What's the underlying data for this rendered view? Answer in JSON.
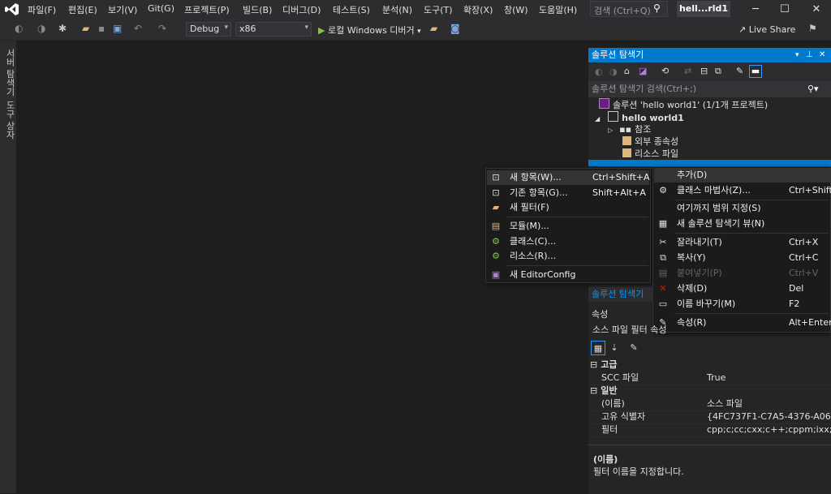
{
  "menubar": {
    "items": [
      "파일(F)",
      "편집(E)",
      "보기(V)",
      "Git(G)",
      "프로젝트(P)",
      "빌드(B)",
      "디버그(D)",
      "테스트(S)",
      "분석(N)",
      "도구(T)",
      "확장(X)",
      "창(W)",
      "도움말(H)"
    ],
    "search_placeholder": "검색 (Ctrl+Q)",
    "window_title": "hell...rld1"
  },
  "toolbar": {
    "config": "Debug",
    "platform": "x86",
    "run_label": "로컬 Windows 디버거",
    "live_share": "Live Share"
  },
  "left_strip": {
    "items": [
      "서버 탐색기",
      "도구 상자"
    ]
  },
  "solution_explorer": {
    "title": "솔루션 탐색기",
    "search_placeholder": "솔루션 탐색기 검색(Ctrl+;)",
    "tree": [
      {
        "label": "솔루션 'hello world1' (1/1개 프로젝트)",
        "icon": "solution-icon"
      },
      {
        "label": "hello world1",
        "icon": "project-icon"
      },
      {
        "label": "참조",
        "icon": "references-icon"
      },
      {
        "label": "외부 종속성",
        "icon": "external-deps-icon"
      },
      {
        "label": "리소스 파일",
        "icon": "folder-icon"
      }
    ]
  },
  "add_submenu": {
    "items": [
      {
        "label": "새 항목(W)...",
        "shortcut": "Ctrl+Shift+A",
        "icon": "new-item-icon"
      },
      {
        "label": "기존 항목(G)...",
        "shortcut": "Shift+Alt+A",
        "icon": "existing-item-icon"
      },
      {
        "label": "새 필터(F)",
        "shortcut": "",
        "icon": "new-filter-icon"
      },
      {
        "label": "모듈(M)...",
        "shortcut": "",
        "icon": "module-icon"
      },
      {
        "label": "클래스(C)...",
        "shortcut": "",
        "icon": "class-icon"
      },
      {
        "label": "리소스(R)...",
        "shortcut": "",
        "icon": "resource-icon"
      },
      {
        "label": "새 EditorConfig",
        "shortcut": "",
        "icon": "editorconfig-icon"
      }
    ]
  },
  "context_menu": {
    "items": [
      {
        "label": "추가(D)",
        "shortcut": "",
        "icon": ""
      },
      {
        "label": "클래스 마법사(Z)...",
        "shortcut": "Ctrl+Shift+X",
        "icon": "class-wizard-icon"
      },
      {
        "label": "여기까지 범위 지정(S)",
        "shortcut": "",
        "icon": ""
      },
      {
        "label": "새 솔루션 탐색기 뷰(N)",
        "shortcut": "",
        "icon": "new-view-icon"
      },
      {
        "label": "잘라내기(T)",
        "shortcut": "Ctrl+X",
        "icon": "cut-icon"
      },
      {
        "label": "복사(Y)",
        "shortcut": "Ctrl+C",
        "icon": "copy-icon"
      },
      {
        "label": "붙여넣기(P)",
        "shortcut": "Ctrl+V",
        "icon": "paste-icon"
      },
      {
        "label": "삭제(D)",
        "shortcut": "Del",
        "icon": "delete-icon"
      },
      {
        "label": "이름 바꾸기(M)",
        "shortcut": "F2",
        "icon": "rename-icon"
      },
      {
        "label": "속성(R)",
        "shortcut": "Alt+Enter",
        "icon": "wrench-icon"
      }
    ]
  },
  "tab_strip": {
    "label": "솔루션 탐색기"
  },
  "properties": {
    "title": "속성",
    "object": "소스 파일 필터 속성",
    "categories": [
      {
        "name": "고급",
        "rows": [
          {
            "key": "SCC 파일",
            "value": "True"
          }
        ]
      },
      {
        "name": "일반",
        "rows": [
          {
            "key": "(이름)",
            "value": "소스 파일"
          },
          {
            "key": "고유 식별자",
            "value": "{4FC737F1-C7A5-4376-A066-2"
          },
          {
            "key": "필터",
            "value": "cpp;c;cc;cxx;c++;cppm;ixx;def;o"
          }
        ]
      }
    ],
    "desc_title": "(이름)",
    "desc_text": "필터 이름을 지정합니다."
  },
  "colors": {
    "accent": "#007acc",
    "background": "#1e1e1e",
    "panel": "#252526",
    "delete_red": "#e51400"
  }
}
